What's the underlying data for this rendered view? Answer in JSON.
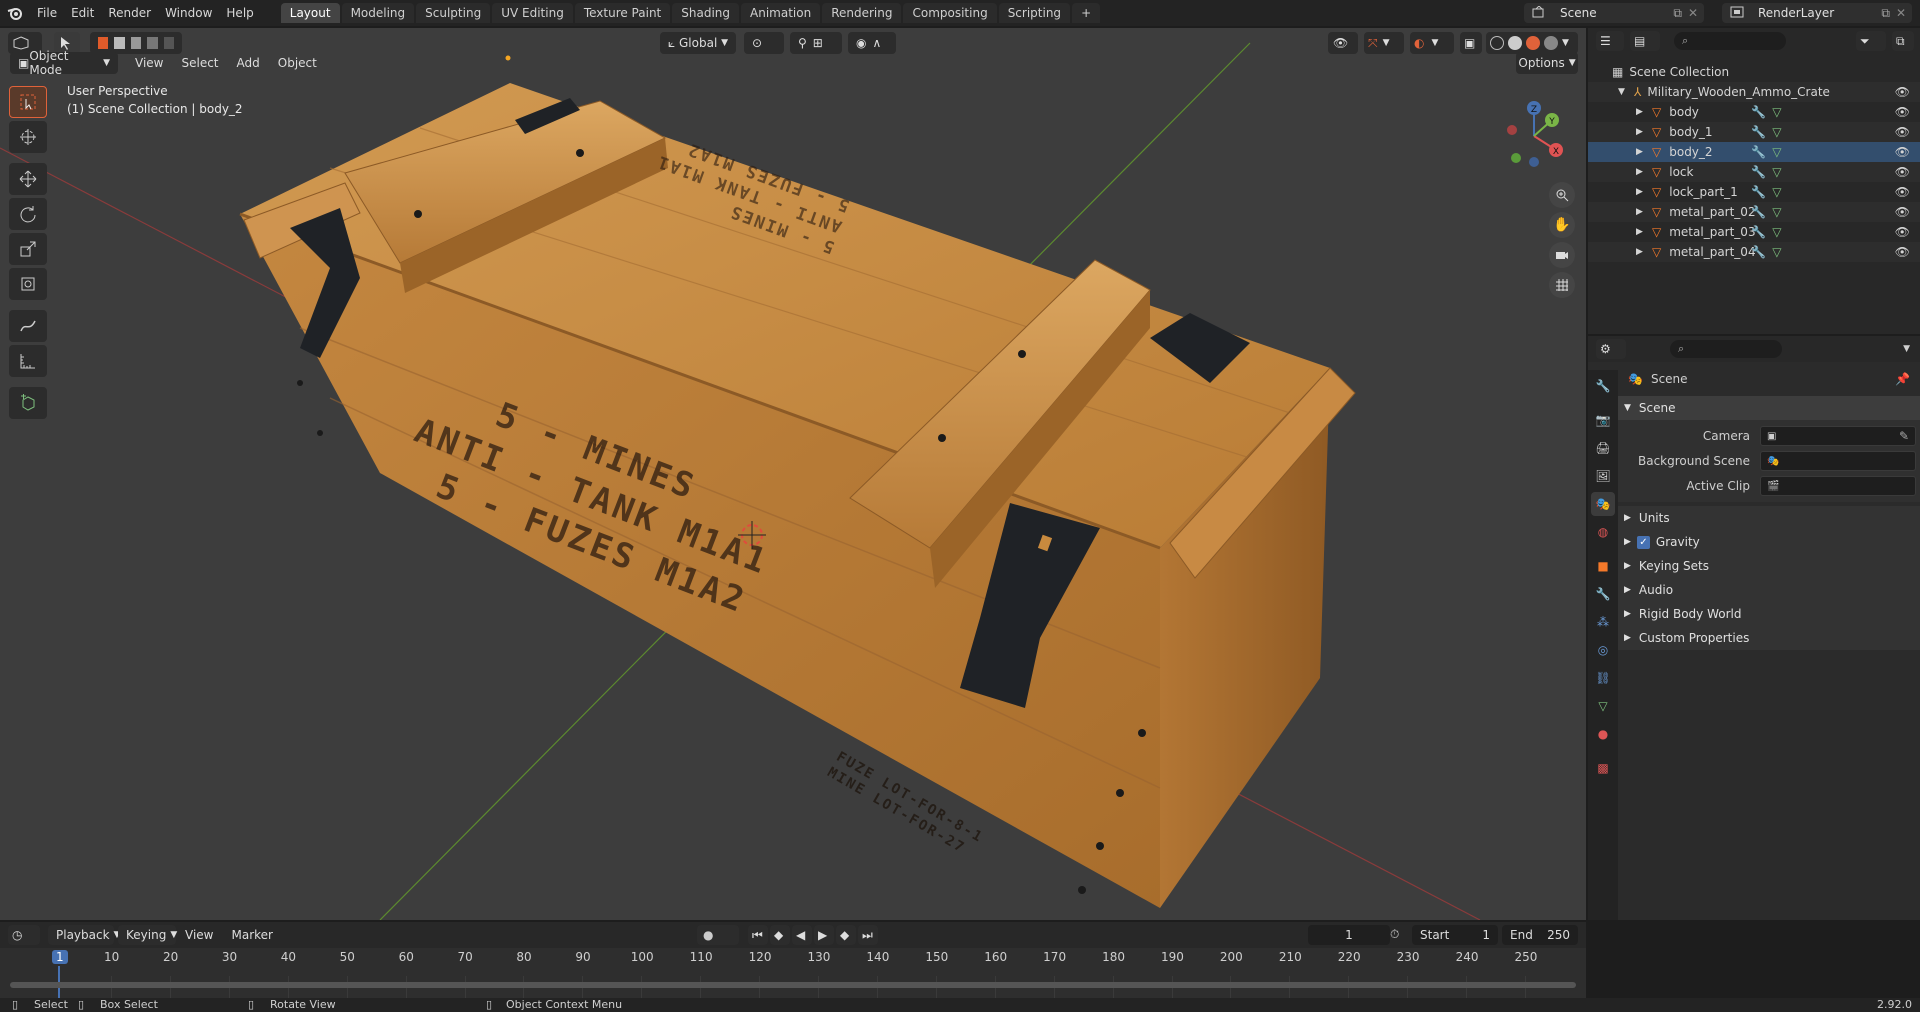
{
  "menubar": {
    "items": [
      "File",
      "Edit",
      "Render",
      "Window",
      "Help"
    ],
    "workspaces": [
      "Layout",
      "Modeling",
      "Sculpting",
      "UV Editing",
      "Texture Paint",
      "Shading",
      "Animation",
      "Rendering",
      "Compositing",
      "Scripting"
    ],
    "active_workspace": "Layout",
    "add_tab": "+",
    "scene_name": "Scene",
    "view_layer": "RenderLayer"
  },
  "viewport": {
    "mode": "Object Mode",
    "menu": [
      "View",
      "Select",
      "Add",
      "Object"
    ],
    "transform_orientation": "Global",
    "options_label": "Options",
    "perspective_label": "User Perspective",
    "collection_label": "(1) Scene Collection | body_2",
    "gizmo_axes": {
      "x": "X",
      "y": "Y",
      "z": "Z"
    },
    "crate_text": {
      "line1": "5 - MINES",
      "line2": "ANTI - TANK M1A1",
      "line3": "5 - FUZES M1A2",
      "top_line1": "5 - MINES",
      "top_line2": "ANTI - TANK M1A1",
      "top_line3": "5 - FUZES M1A2",
      "side_line1": "FUZE LOT-FOR-8-1",
      "side_line2": "MINE LOT-FOR-27"
    }
  },
  "outliner": {
    "root": "Scene Collection",
    "collection": "Military_Wooden_Ammo_Crate",
    "objects": [
      "body",
      "body_1",
      "body_2",
      "lock",
      "lock_part_1",
      "metal_part_02",
      "metal_part_03",
      "metal_part_04"
    ],
    "selected": "body_2"
  },
  "properties": {
    "context": "Scene",
    "section_scene": "Scene",
    "camera_label": "Camera",
    "background_scene_label": "Background Scene",
    "active_clip_label": "Active Clip",
    "sections": [
      "Units",
      "Gravity",
      "Keying Sets",
      "Audio",
      "Rigid Body World",
      "Custom Properties"
    ],
    "gravity_checked": true
  },
  "timeline": {
    "menu": [
      "Playback",
      "Keying",
      "View",
      "Marker"
    ],
    "current_frame": "1",
    "start_label": "Start",
    "start_value": "1",
    "end_label": "End",
    "end_value": "250",
    "ruler_labels": [
      "1",
      "10",
      "20",
      "30",
      "40",
      "50",
      "60",
      "70",
      "80",
      "90",
      "100",
      "110",
      "120",
      "130",
      "140",
      "150",
      "160",
      "170",
      "180",
      "190",
      "200",
      "210",
      "220",
      "230",
      "240",
      "250"
    ]
  },
  "statusbar": {
    "select": "Select",
    "box_select": "Box Select",
    "rotate_view": "Rotate View",
    "context_menu": "Object Context Menu",
    "version": "2.92.0"
  },
  "colors": {
    "accent_orange": "#f5792a",
    "active_blue": "#4772b3",
    "wood": "#c88a3e",
    "metal": "#1f2226"
  }
}
